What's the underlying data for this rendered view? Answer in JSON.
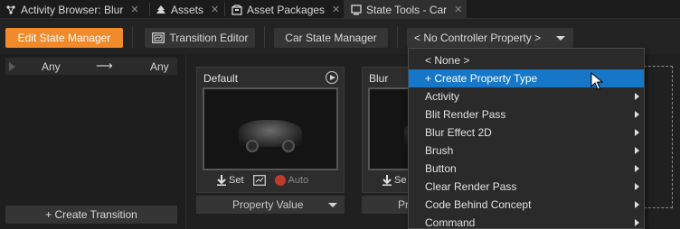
{
  "tabs": [
    {
      "label": "Activity Browser: Blur",
      "icon": "activity-icon"
    },
    {
      "label": "Assets",
      "icon": "tree-icon"
    },
    {
      "label": "Asset Packages",
      "icon": "package-icon"
    },
    {
      "label": "State Tools - Car",
      "icon": "window-icon",
      "active": true
    }
  ],
  "tab_close": "✕",
  "toolbar": {
    "edit_state_manager": "Edit State Manager",
    "transition_editor": "Transition Editor",
    "state_manager_name": "Car State Manager",
    "controller_property": "< No Controller Property >"
  },
  "left_panel": {
    "any_from": "Any",
    "any_to": "Any",
    "arrow": "⟶",
    "create_transition": "+ Create Transition"
  },
  "cards": [
    {
      "title": "Default",
      "set": "Set",
      "auto": "Auto",
      "property_value": "Property Value"
    },
    {
      "title": "Blur",
      "set": "Se",
      "property_value": "Pr"
    }
  ],
  "menu": {
    "items": [
      {
        "label": "< None >",
        "submenu": false,
        "indent": true
      },
      {
        "label": "+ Create Property Type",
        "submenu": false,
        "highlighted": true
      },
      {
        "label": "Activity",
        "submenu": true
      },
      {
        "label": "Blit Render Pass",
        "submenu": true
      },
      {
        "label": "Blur Effect 2D",
        "submenu": true
      },
      {
        "label": "Brush",
        "submenu": true
      },
      {
        "label": "Button",
        "submenu": true
      },
      {
        "label": "Clear Render Pass",
        "submenu": true
      },
      {
        "label": "Code Behind Concept",
        "submenu": true
      },
      {
        "label": "Command",
        "submenu": true
      }
    ]
  },
  "colors": {
    "accent_orange": "#f08a2b",
    "highlight_blue": "#1677c8",
    "background": "#232323"
  }
}
